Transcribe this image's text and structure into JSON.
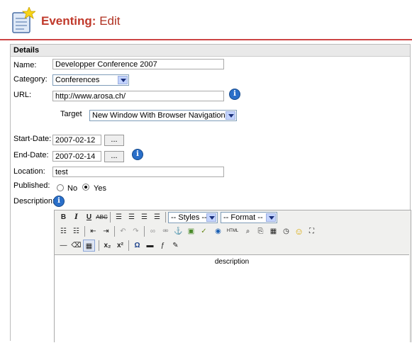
{
  "header": {
    "title": "Eventing:",
    "subtitle": "Edit"
  },
  "details": {
    "heading": "Details"
  },
  "form": {
    "name": {
      "label": "Name:",
      "value": "Developper Conference 2007"
    },
    "category": {
      "label": "Category:",
      "value": "Conferences"
    },
    "url": {
      "label": "URL:",
      "value": "http://www.arosa.ch/"
    },
    "target": {
      "label": "Target",
      "value": "New Window With Browser Navigation"
    },
    "start_date": {
      "label": "Start-Date:",
      "value": "2007-02-12",
      "button": "..."
    },
    "end_date": {
      "label": "End-Date:",
      "value": "2007-02-14",
      "button": "..."
    },
    "location": {
      "label": "Location:",
      "value": "test"
    },
    "published": {
      "label": "Published:",
      "options": [
        "No",
        "Yes"
      ],
      "selected": "Yes"
    },
    "description": {
      "label": "Description:"
    }
  },
  "editor": {
    "styles_select": "-- Styles --",
    "format_select": "-- Format --",
    "content": "description",
    "icons_row1": [
      "bold-icon",
      "italic-icon",
      "underline-icon",
      "strikethrough-icon",
      "align-left-icon",
      "align-center-icon",
      "align-right-icon",
      "align-justify-icon"
    ],
    "icons_row2": [
      "bullet-list-icon",
      "numbered-list-icon",
      "outdent-icon",
      "indent-icon",
      "undo-icon",
      "redo-icon",
      "link-icon",
      "unlink-icon",
      "anchor-icon",
      "image-icon",
      "cleanup-icon",
      "help-icon",
      "html-icon",
      "search-icon",
      "replace-icon",
      "date-icon",
      "time-icon",
      "emoticon-icon",
      "fullscreen-icon"
    ],
    "icons_row3": [
      "hr-icon",
      "eraser-icon",
      "table-icon",
      "subscript-icon",
      "superscript-icon",
      "charmap-icon",
      "media-icon",
      "flash-icon",
      "edit-icon"
    ]
  }
}
